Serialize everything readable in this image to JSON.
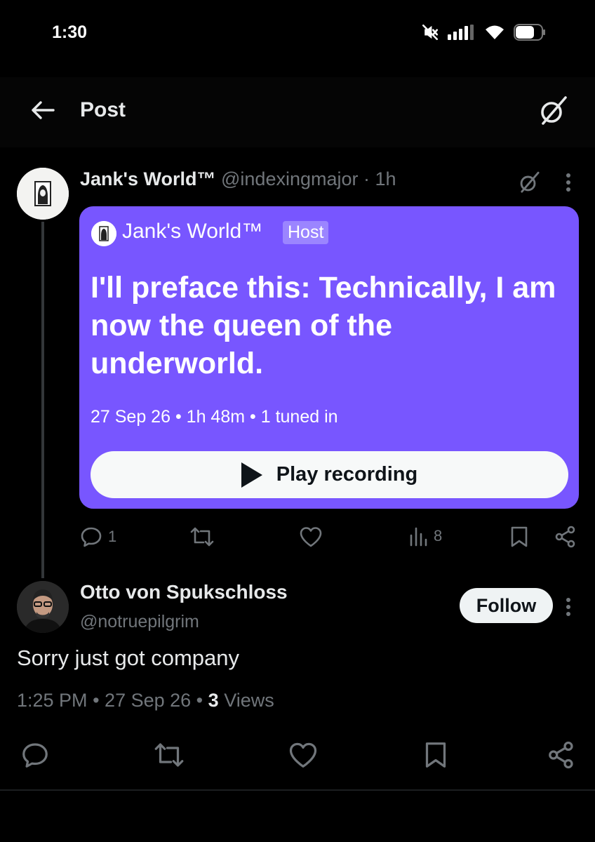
{
  "status_bar": {
    "time": "1:30"
  },
  "header": {
    "title": "Post"
  },
  "post": {
    "author_name": "Jank's World™",
    "author_handle": "@indexingmajor",
    "separator": "·",
    "time_ago": "1h",
    "space": {
      "host_name": "Jank's World™",
      "host_badge": "Host",
      "title": "I'll preface this: Technically, I am now the queen of the underworld.",
      "date": "27 Sep 26",
      "duration": "1h 48m",
      "tuned_in": "1 tuned in",
      "dot": "•",
      "play_label": "Play recording",
      "card_color": "#7856ff"
    },
    "actions": {
      "replies": "1",
      "views": "8"
    }
  },
  "reply": {
    "author_name": "Otto von Spukschloss",
    "author_handle": "@notruepilgrim",
    "follow_label": "Follow",
    "text": "Sorry just got company",
    "time": "1:25 PM",
    "date": "27 Sep 26",
    "dot": "•",
    "views_count": "3",
    "views_label": "Views"
  }
}
